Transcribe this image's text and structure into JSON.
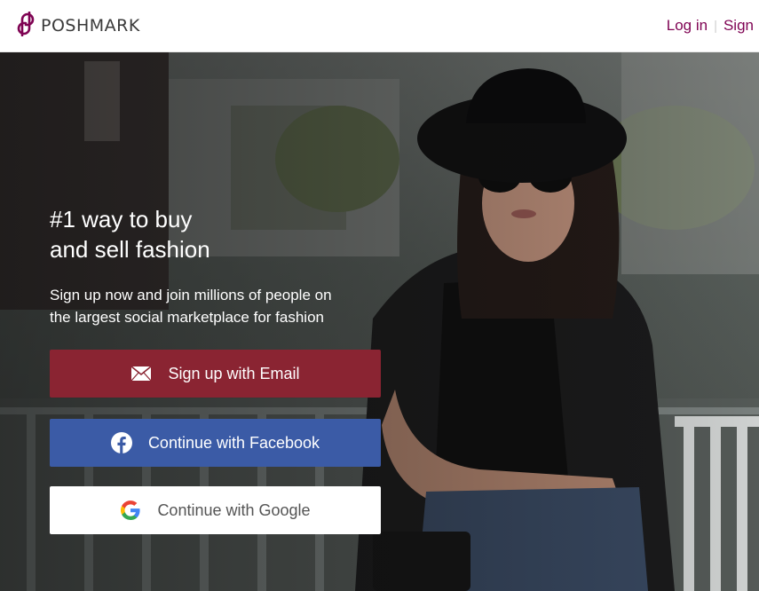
{
  "header": {
    "brand": "POSHMARK",
    "login_label": "Log in",
    "signup_label": "Sign"
  },
  "hero": {
    "headline_line1": "#1 way to buy",
    "headline_line2": "and sell fashion",
    "subtext_line1": "Sign up now and join millions of people on",
    "subtext_line2": "the largest social marketplace for fashion"
  },
  "buttons": {
    "email": "Sign up with Email",
    "facebook": "Continue with Facebook",
    "google": "Continue with Google"
  },
  "colors": {
    "brand": "#7f0353",
    "email_button": "#8a2432",
    "facebook_button": "#3b5ba6",
    "google_button": "#ffffff"
  },
  "icons": {
    "logo": "poshmark-logo-icon",
    "email": "envelope-icon",
    "facebook": "facebook-icon",
    "google": "google-icon"
  }
}
